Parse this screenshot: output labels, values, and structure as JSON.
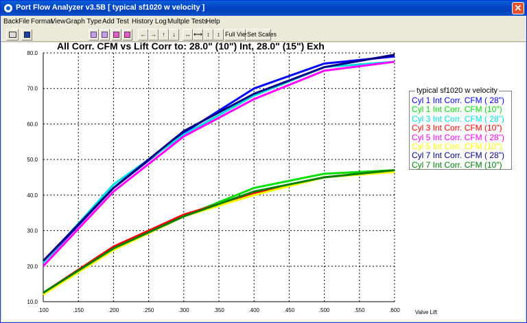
{
  "window": {
    "title": "Port Flow Analyzer v3.5B  [ typical sf1020 w velocity ]",
    "close_glyph": "✕"
  },
  "menu": [
    "Back",
    "File",
    "Format",
    "View",
    "Graph Type",
    "Add Test",
    "History Log",
    "Multple Tests",
    "Help"
  ],
  "toolbar": {
    "full_view": "Full View",
    "set_scales": "Set Scales",
    "nav_glyphs": [
      "←",
      "→",
      "↑",
      "↓"
    ],
    "zoom_glyphs": [
      "↔",
      "⟷",
      "↕",
      "↕"
    ]
  },
  "chart_data": {
    "type": "line",
    "title": "All Corr. CFM vs Lift    Corr to: 28.0\" (10\") Int, 28.0\" (15\") Exh",
    "xlabel": "Valve Lift",
    "ylabel": "",
    "xlim": [
      0.1,
      0.6
    ],
    "ylim": [
      10,
      80
    ],
    "x_tick_labels": [
      ".100",
      ".150",
      ".200",
      ".250",
      ".300",
      ".350",
      ".400",
      ".450",
      ".500",
      ".550",
      ".600"
    ],
    "y_tick_labels": [
      "10.0",
      "20.0",
      "30.0",
      "40.0",
      "50.0",
      "60.0",
      "70.0",
      "80.0"
    ],
    "grid": true,
    "legend_title": "typical sf1020 w velocity",
    "x": [
      0.1,
      0.2,
      0.3,
      0.4,
      0.5,
      0.6
    ],
    "series": [
      {
        "name": "Cyl 1 Int Corr. CFM ( 28\")",
        "color": "#0000ff",
        "values": [
          21.0,
          42.0,
          57.5,
          70.0,
          77.0,
          79.0
        ]
      },
      {
        "name": "Cyl 1 Int Corr. CFM (10\")",
        "color": "#00e000",
        "values": [
          12.5,
          25.0,
          34.0,
          42.0,
          46.0,
          47.0
        ]
      },
      {
        "name": "Cyl 3 Int Corr. CFM ( 28\")",
        "color": "#00e0e0",
        "values": [
          21.0,
          43.0,
          57.0,
          68.0,
          76.0,
          77.5
        ]
      },
      {
        "name": "Cyl 3 Int Corr. CFM (10\")",
        "color": "#ff0000",
        "values": [
          12.5,
          25.5,
          34.5,
          40.5,
          45.0,
          47.0
        ]
      },
      {
        "name": "Cyl 5 Int Corr. CFM ( 28\")",
        "color": "#ff00ff",
        "values": [
          20.0,
          41.0,
          56.5,
          67.0,
          75.0,
          77.5
        ]
      },
      {
        "name": "Cyl 5 Int Corr. CFM (10\")",
        "color": "#ffff00",
        "values": [
          12.0,
          24.5,
          34.0,
          40.0,
          45.0,
          46.5
        ]
      },
      {
        "name": "Cyl 7 Int Corr. CFM ( 28\")",
        "color": "#000080",
        "values": [
          21.5,
          42.0,
          58.0,
          68.5,
          76.0,
          79.5
        ]
      },
      {
        "name": "Cyl 7 Int Corr. CFM (10\")",
        "color": "#008000",
        "values": [
          12.5,
          25.0,
          34.0,
          41.0,
          45.0,
          47.0
        ]
      }
    ]
  }
}
